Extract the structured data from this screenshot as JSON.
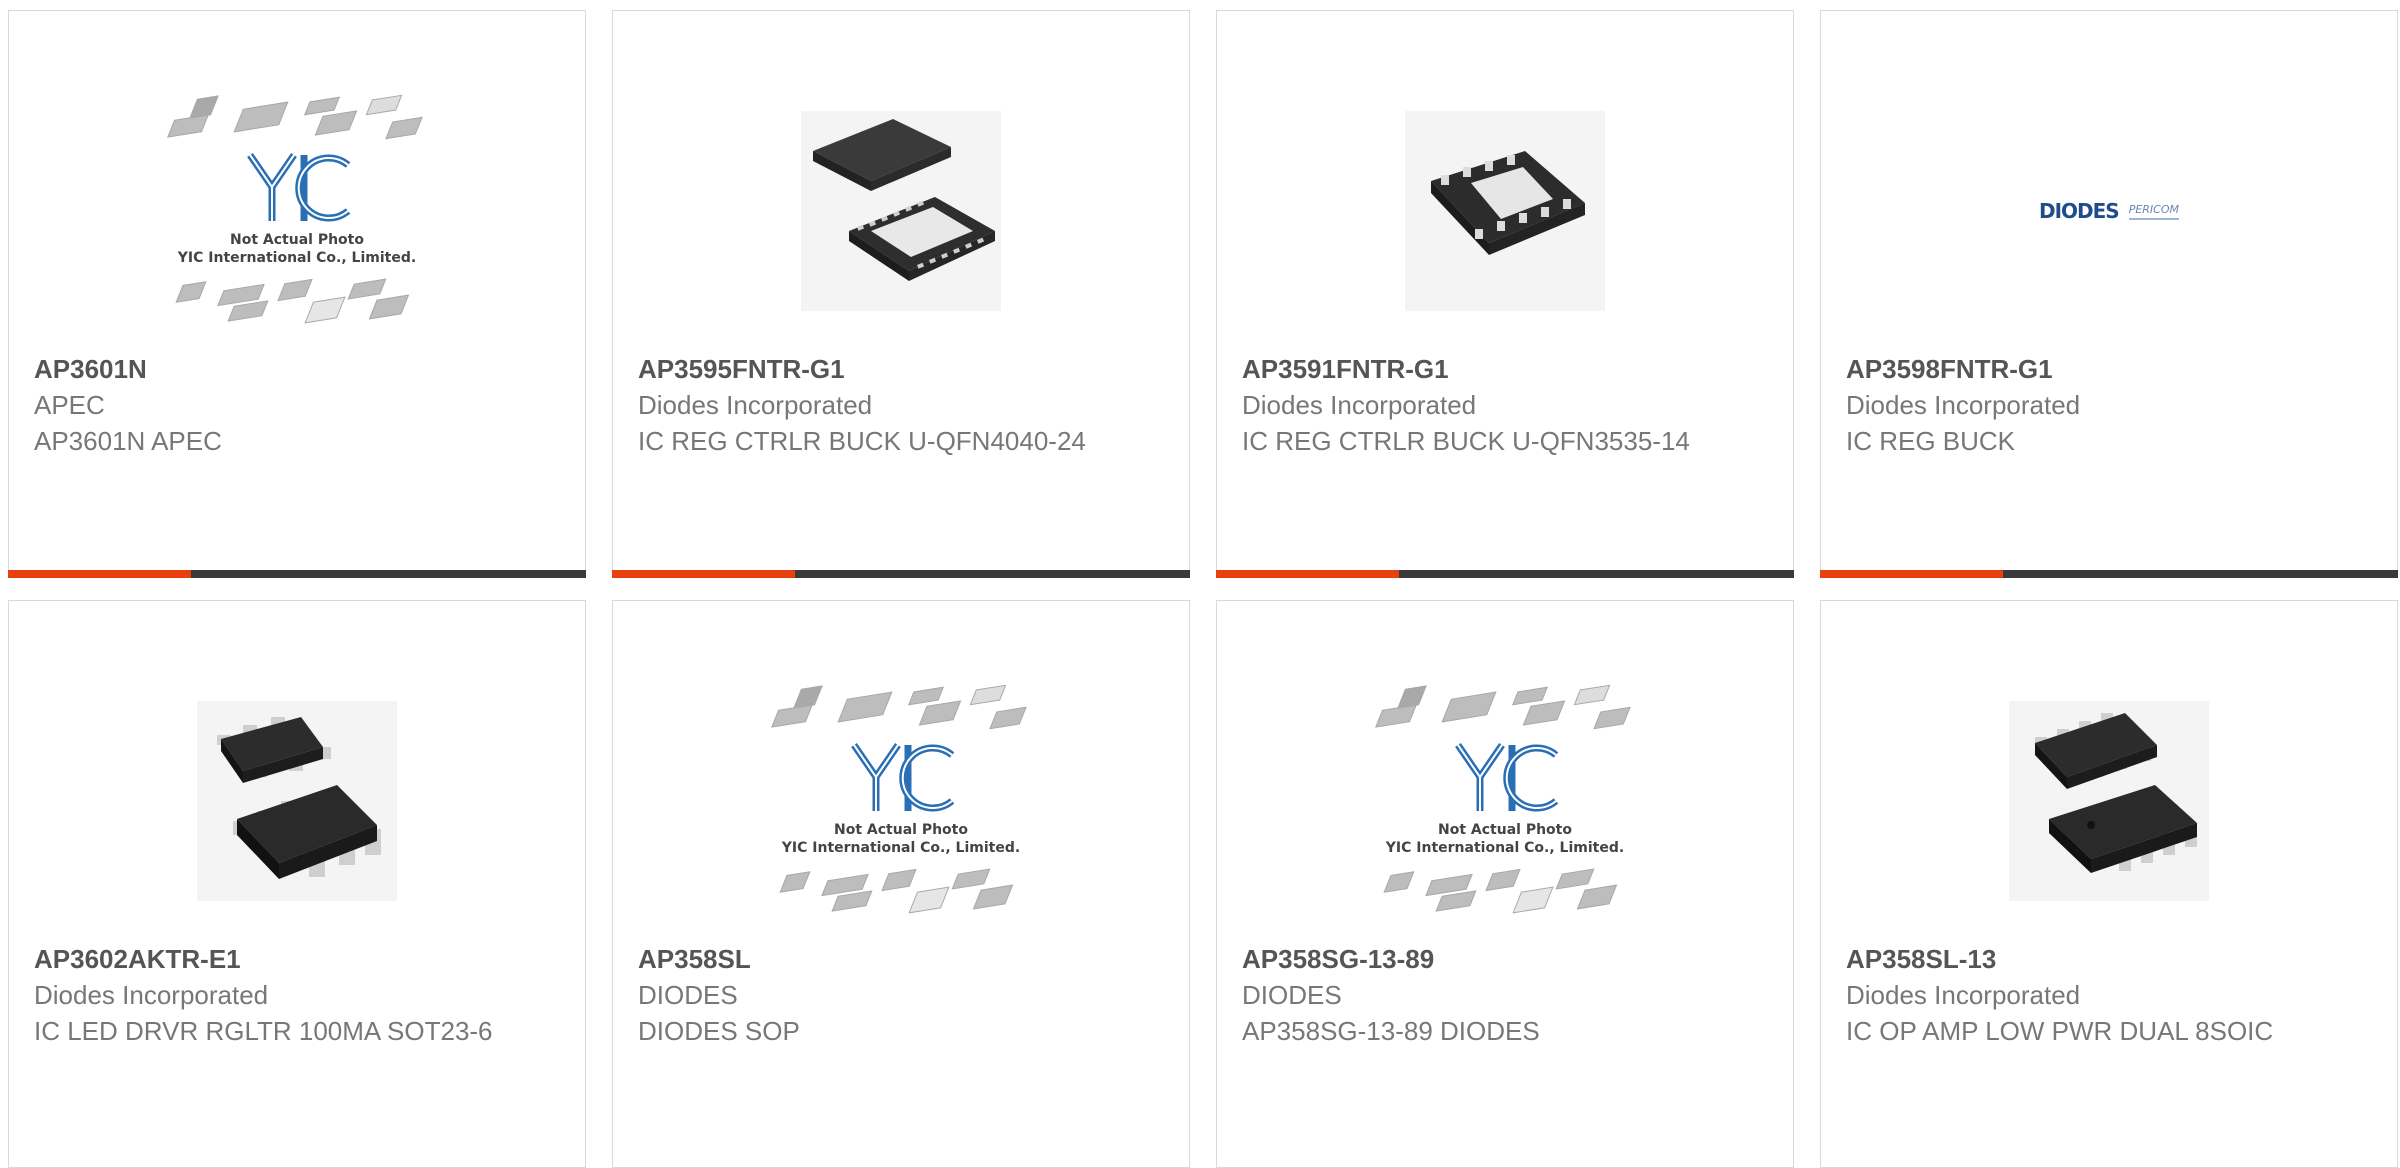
{
  "products": [
    {
      "part_number": "AP3601N",
      "manufacturer": "APEC",
      "description": "AP3601N APEC",
      "image": "placeholder"
    },
    {
      "part_number": "AP3595FNTR-G1",
      "manufacturer": "Diodes Incorporated",
      "description": "IC REG CTRLR BUCK U-QFN4040-24",
      "image": "qfn24"
    },
    {
      "part_number": "AP3591FNTR-G1",
      "manufacturer": "Diodes Incorporated",
      "description": "IC REG CTRLR BUCK U-QFN3535-14",
      "image": "qfn14"
    },
    {
      "part_number": "AP3598FNTR-G1",
      "manufacturer": "Diodes Incorporated",
      "description": "IC REG BUCK",
      "image": "diodes-logo"
    },
    {
      "part_number": "AP3602AKTR-E1",
      "manufacturer": "Diodes Incorporated",
      "description": "IC LED DRVR RGLTR 100MA SOT23-6",
      "image": "sot23"
    },
    {
      "part_number": "AP358SL",
      "manufacturer": "DIODES",
      "description": "DIODES SOP",
      "image": "placeholder"
    },
    {
      "part_number": "AP358SG-13-89",
      "manufacturer": "DIODES",
      "description": "AP358SG-13-89 DIODES",
      "image": "placeholder"
    },
    {
      "part_number": "AP358SL-13",
      "manufacturer": "Diodes Incorporated",
      "description": "IC OP AMP LOW PWR DUAL 8SOIC",
      "image": "soic8"
    }
  ],
  "placeholder": {
    "line1": "Not Actual Photo",
    "line2": "YIC International Co., Limited."
  },
  "logo_text": {
    "diodes": "DIODES",
    "pericom": "PERICOM"
  },
  "colors": {
    "accent": "#e8410f",
    "bar": "#3a3a3a",
    "border": "#d9d9d9"
  }
}
